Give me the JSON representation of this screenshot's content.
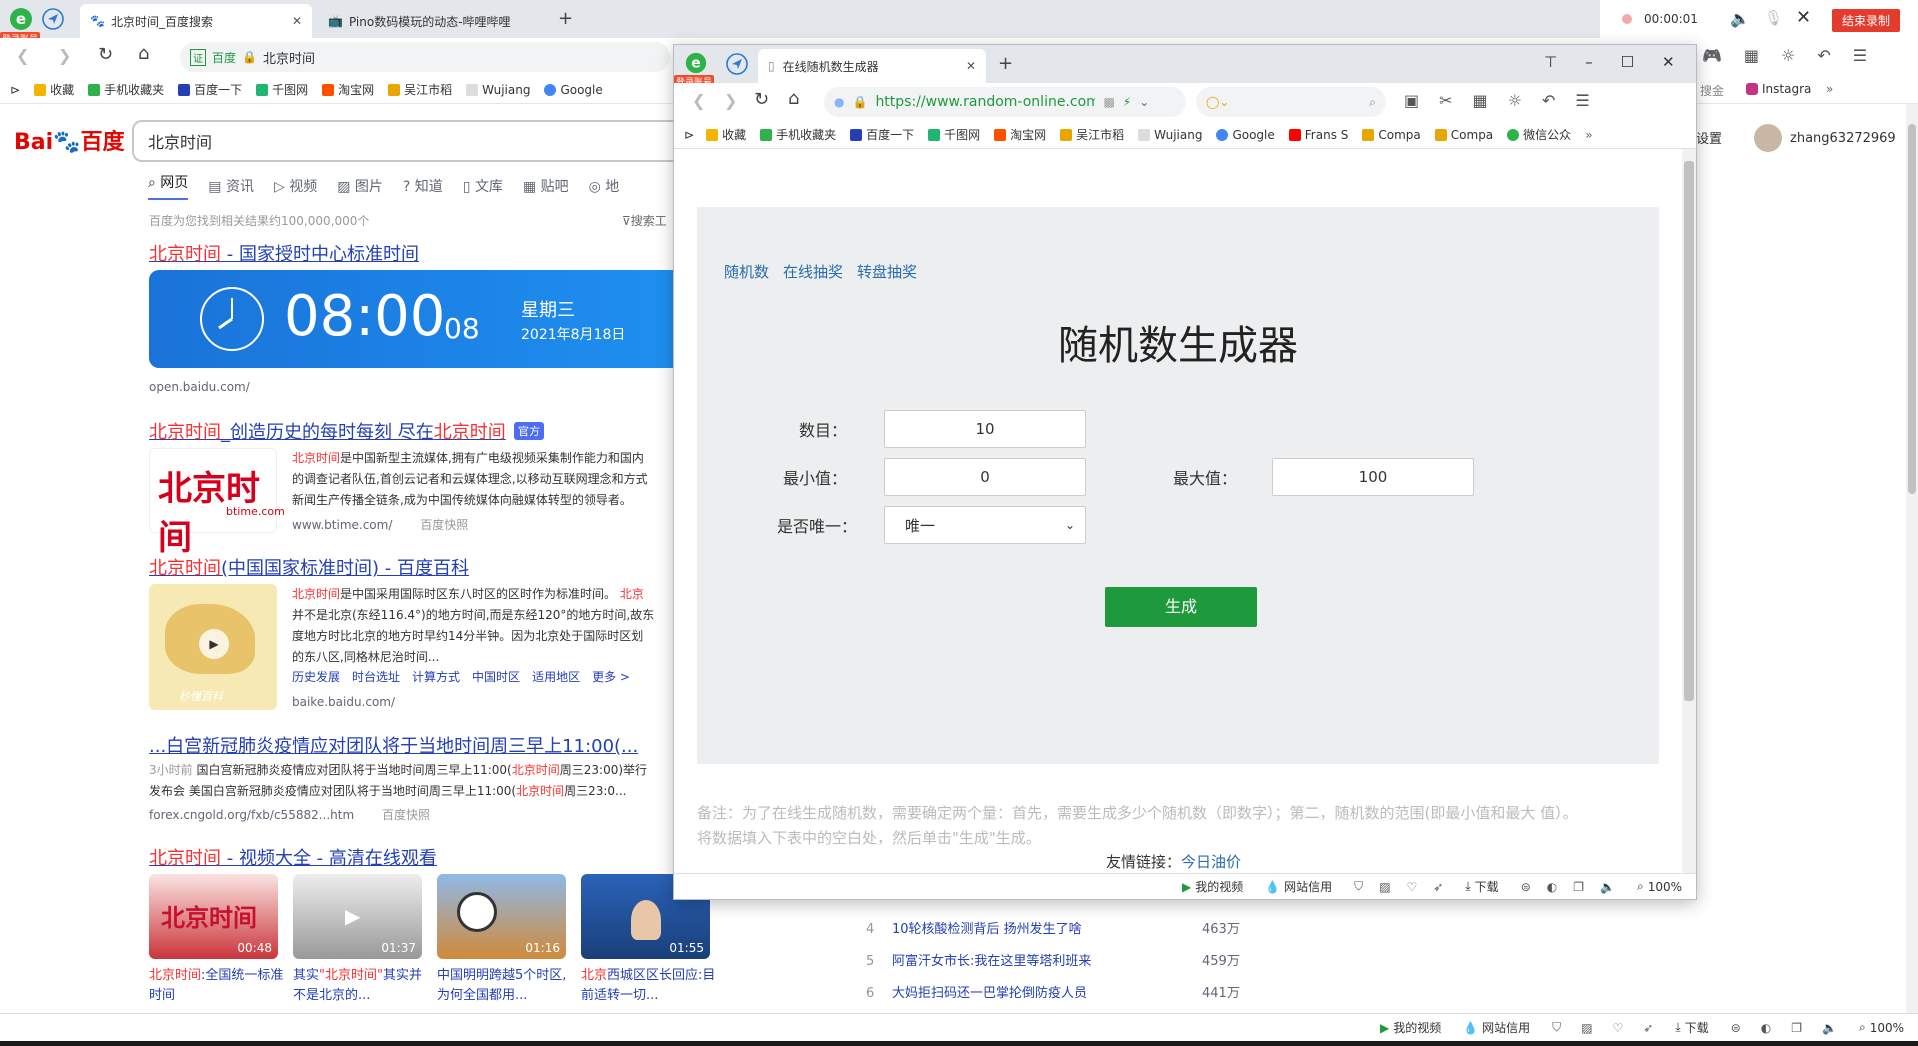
{
  "outer_browser": {
    "login_badge": "登录账号",
    "tabs": [
      {
        "title": "北京时间_百度搜索",
        "active": true
      },
      {
        "title": "Pino数码模玩的动态-哔哩哔哩",
        "active": false
      }
    ],
    "recording_time": "00:00:01",
    "end_record_label": "结束录制",
    "address_site": "百度",
    "address_text": "北京时间",
    "bookmarks": [
      "收藏",
      "手机收藏夹",
      "百度一下",
      "千图网",
      "淘宝网",
      "吴江市稻",
      "Wujiang",
      "Google"
    ],
    "right_partial_bookmarks": [
      "搜金",
      "Instagra"
    ]
  },
  "baidu": {
    "logo_text": "Bai",
    "logo_text2": "百度",
    "search_value": "北京时间",
    "nav_tabs": [
      "网页",
      "资讯",
      "视频",
      "图片",
      "知道",
      "文库",
      "贴吧",
      "地"
    ],
    "result_count": "百度为您找到相关结果约100,000,000个",
    "search_tools": "搜索工",
    "settings": "设置",
    "username": "zhang63272969",
    "r1": {
      "title_hl": "北京时间",
      "title_rest": " - 国家授时中心标准时间",
      "clock_time": "08:00",
      "clock_sec": "08",
      "weekday": "星期三",
      "date": "2021年8月18日",
      "url": "open.baidu.com/"
    },
    "r2": {
      "title_a": "北京时间",
      "title_b": "_创造历史的每时每刻 尽在",
      "title_c": "北京时间",
      "badge": "官方",
      "logo_cn": "北京时间",
      "logo_en": "btime.com",
      "line1_hl": "北京时间",
      "line1_rest": "是中国新型主流媒体,拥有广电级视频采集制作能力和国内",
      "line2": "的调查记者队伍,首创云记者和云媒体理念,以移动互联网理念和方式",
      "line3": "新闻生产传播全链条,成为中国传统媒体向融媒体转型的领导者。",
      "url": "www.btime.com/",
      "snapshot": "百度快照"
    },
    "r3": {
      "title_hl": "北京时间",
      "title_rest": "(中国国家标准时间) - 百度百科",
      "line1_hl": "北京时间",
      "line1_rest": "是中国采用国际时区东八时区的区时作为标准时间。",
      "line1_tail": "北京",
      "line2": "并不是北京(东经116.4°)的地方时间,而是东经120°的地方时间,故东",
      "line3": "度地方时比北京的地方时早约14分半钟。因为北京处于国际时区划",
      "line4": "的东八区,同格林尼治时间...",
      "links": [
        "历史发展",
        "时台选址",
        "计算方式",
        "中国时区",
        "适用地区",
        "更多 >"
      ],
      "url": "baike.baidu.com/",
      "thumb_label": "秒懂百科"
    },
    "r4": {
      "title": "...白宫新冠肺炎疫情应对团队将于当地时间周三早上11:00(...",
      "line1_pre": "3小时前",
      "line1_body": "国白宫新冠肺炎疫情应对团队将于当地时间周三早上11:00(",
      "line1_hl": "北京时间",
      "line1_tail": "周三23:00)举行",
      "line2_pre": "发布会 美国白宫新冠肺炎疫情应对团队将于当地时间周三早上11:00(",
      "line2_hl": "北京时间",
      "line2_tail": "周三23:0...",
      "url": "forex.cngold.org/fxb/c55882...htm",
      "snapshot": "百度快照"
    },
    "r5": {
      "title_hl": "北京时间",
      "title_rest": " - 视频大全 - 高清在线观看",
      "videos": [
        {
          "duration": "00:48",
          "caption_hl": "北京时间",
          "caption": ":全国统一标准时间",
          "thumb_text": "北京时间"
        },
        {
          "duration": "01:37",
          "caption_pre": "其实",
          "caption_hl": "\"北京时间\"",
          "caption": "其实并不是北京的..."
        },
        {
          "duration": "01:16",
          "caption": "中国明明跨越5个时区,为何全国都用..."
        },
        {
          "duration": "01:55",
          "caption_hl": "北京",
          "caption": "西城区区长回应:目前适转一切..."
        }
      ]
    },
    "hot_list": [
      {
        "rank": "4",
        "title": "10轮核酸检测背后 扬州发生了啥",
        "heat": "463万"
      },
      {
        "rank": "5",
        "title": "阿富汗女市长:我在这里等塔利班来",
        "heat": "459万"
      },
      {
        "rank": "6",
        "title": "大妈拒扫码还一巴掌抡倒防疫人员",
        "heat": "441万"
      }
    ]
  },
  "random_window": {
    "login_badge": "登录账号",
    "tab_title": "在线随机数生成器",
    "url": "https://www.random-online.com",
    "bookmarks": [
      "收藏",
      "手机收藏夹",
      "百度一下",
      "千图网",
      "淘宝网",
      "吴江市稻",
      "Wujiang",
      "Google",
      "Frans S",
      "Compa",
      "Compa",
      "微信公众"
    ],
    "page": {
      "nav": [
        "随机数",
        "在线抽奖",
        "转盘抽奖"
      ],
      "title": "随机数生成器",
      "count_label": "数目：",
      "count_value": "10",
      "min_label": "最小值：",
      "min_value": "0",
      "max_label": "最大值：",
      "max_value": "100",
      "unique_label": "是否唯一：",
      "unique_value": "唯一",
      "generate_label": "生成",
      "note_line1": "备注：为了在线生成随机数，需要确定两个量：首先，需要生成多少个随机数（即数字）；第二，随机数的范围(即最小值和最大 值）。",
      "note_line2": "将数据填入下表中的空白处，然后单击\"生成\"生成。",
      "friend_links_label": "友情链接：",
      "friend_link": "今日油价"
    },
    "status": {
      "my_video": "我的视频",
      "site_credit": "网站信用",
      "download": "下载",
      "zoom": "100%"
    }
  },
  "bottom_status": {
    "my_video": "我的视频",
    "site_credit": "网站信用",
    "download": "下载",
    "zoom": "100%"
  },
  "colors": {
    "baidu_blue": "#2440b3",
    "baidu_red": "#f73131",
    "generate_green": "#1e9a3c",
    "link_blue": "#2b6dad",
    "clock_blue": "#1a73d9"
  }
}
